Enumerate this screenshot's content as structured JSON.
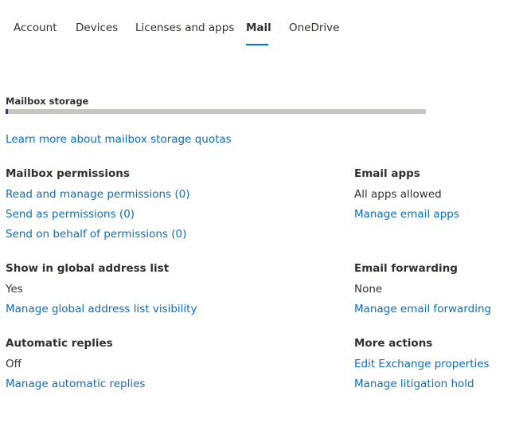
{
  "tabs": [
    {
      "label": "Account",
      "active": false
    },
    {
      "label": "Devices",
      "active": false
    },
    {
      "label": "Licenses and apps",
      "active": false
    },
    {
      "label": "Mail",
      "active": true
    },
    {
      "label": "OneDrive",
      "active": false
    }
  ],
  "colors": {
    "accent": "#0078d4",
    "link": "#0f6cbd",
    "text": "#323130",
    "storage_track": "#c8c6c4",
    "storage_fill": "#0f4a85"
  },
  "mailbox_storage": {
    "title": "Mailbox storage",
    "used_fraction": 0.005,
    "learn_more_link": "Learn more about mailbox storage quotas"
  },
  "mailbox_permissions": {
    "title": "Mailbox permissions",
    "links": [
      "Read and manage permissions (0)",
      "Send as permissions (0)",
      "Send on behalf of permissions (0)"
    ]
  },
  "email_apps": {
    "title": "Email apps",
    "value": "All apps allowed",
    "link": "Manage email apps"
  },
  "global_address_list": {
    "title": "Show in global address list",
    "value": "Yes",
    "link": "Manage global address list visibility"
  },
  "email_forwarding": {
    "title": "Email forwarding",
    "value": "None",
    "link": "Manage email forwarding"
  },
  "automatic_replies": {
    "title": "Automatic replies",
    "value": "Off",
    "link": "Manage automatic replies"
  },
  "more_actions": {
    "title": "More actions",
    "links": [
      "Edit Exchange properties",
      "Manage litigation hold"
    ]
  }
}
